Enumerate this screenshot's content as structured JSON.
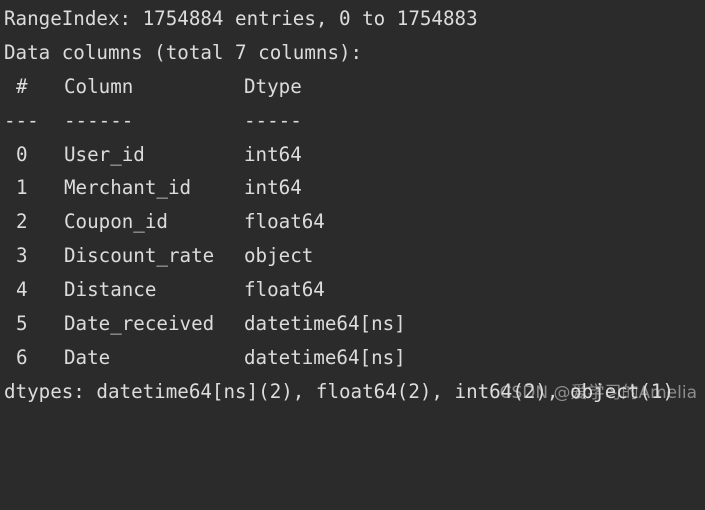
{
  "output": {
    "range_index": "RangeIndex: 1754884 entries, 0 to 1754883",
    "data_columns": "Data columns (total 7 columns):",
    "header": {
      "num": "#",
      "column": "Column",
      "dtype": "Dtype"
    },
    "separator": {
      "num": "---",
      "column": "------",
      "dtype": "-----"
    },
    "rows": [
      {
        "num": "0",
        "column": "User_id",
        "dtype": "int64"
      },
      {
        "num": "1",
        "column": "Merchant_id",
        "dtype": "int64"
      },
      {
        "num": "2",
        "column": "Coupon_id",
        "dtype": "float64"
      },
      {
        "num": "3",
        "column": "Discount_rate",
        "dtype": "object"
      },
      {
        "num": "4",
        "column": "Distance",
        "dtype": "float64"
      },
      {
        "num": "5",
        "column": "Date_received",
        "dtype": "datetime64[ns]"
      },
      {
        "num": "6",
        "column": "Date",
        "dtype": "datetime64[ns]"
      }
    ],
    "dtypes": "dtypes: datetime64[ns](2), float64(2), int64(2), object(1)"
  },
  "watermark": "CSDN @爱学习的Amelia",
  "colors": {
    "background": "#2b2b2b",
    "text": "#dcdcdc"
  }
}
